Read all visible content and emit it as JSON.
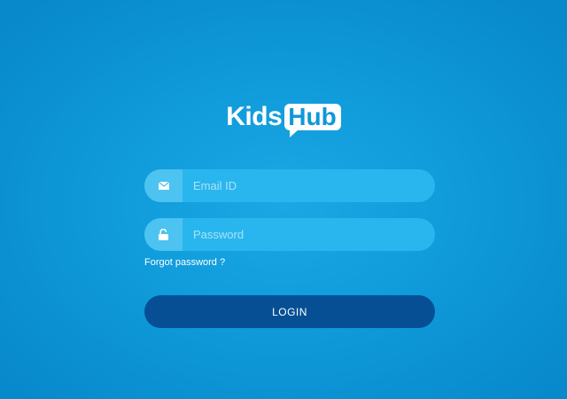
{
  "logo": {
    "part1": "Kids",
    "part2": "Hub"
  },
  "form": {
    "email_placeholder": "Email ID",
    "email_value": "",
    "password_placeholder": "Password",
    "password_value": "",
    "forgot_label": "Forgot password ?",
    "login_label": "LOGIN"
  },
  "icons": {
    "email": "envelope-icon",
    "password": "unlocked-padlock-icon"
  },
  "colors": {
    "background": "#0e98d8",
    "input_bg": "#29b6ee",
    "input_icon_bg": "#4cc3f0",
    "button_bg": "#064f95",
    "text": "#ffffff"
  }
}
